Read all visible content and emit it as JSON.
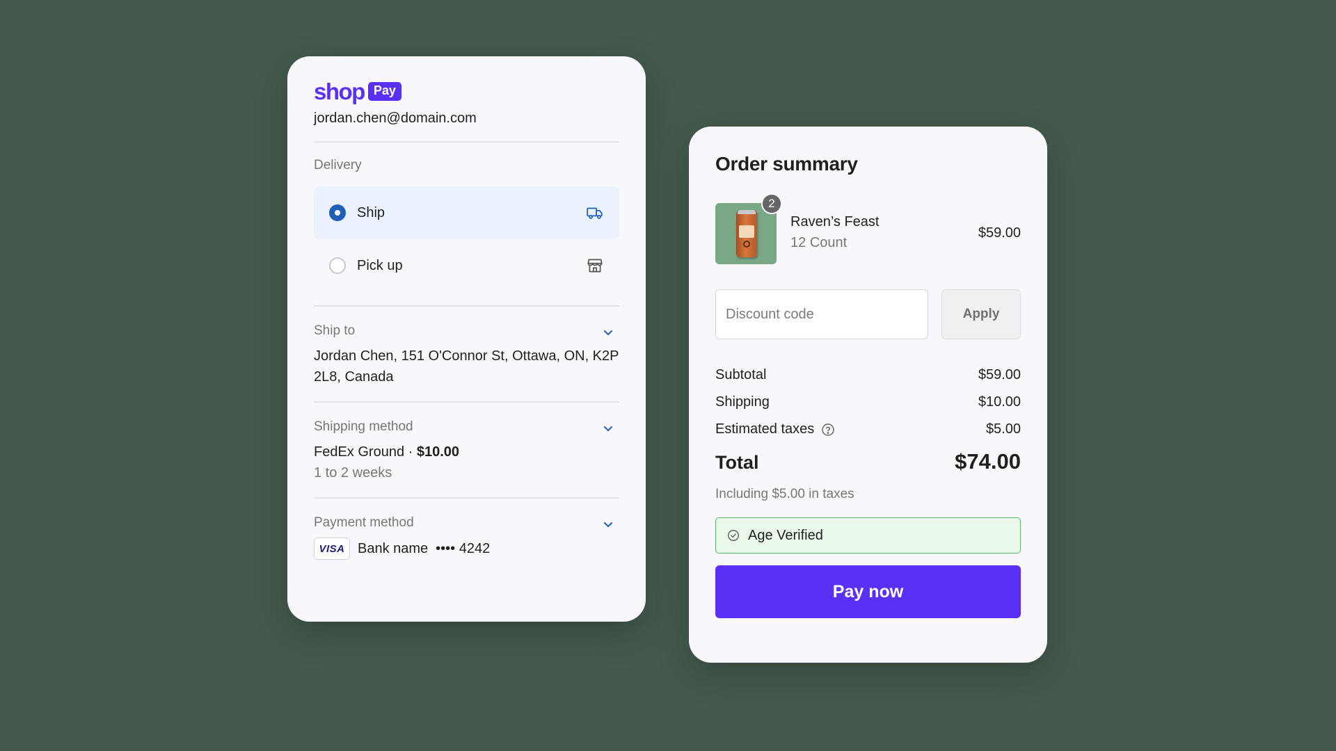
{
  "colors": {
    "background": "#445a4d",
    "brand": "#5a31f4",
    "selected_option": "#ebf2fd",
    "radio_on": "#1e5fb8",
    "age_ok": "#5db56b"
  },
  "checkout": {
    "brand": {
      "shop": "shop",
      "pay": "Pay"
    },
    "email": "jordan.chen@domain.com",
    "delivery": {
      "label": "Delivery",
      "options": [
        {
          "label": "Ship",
          "selected": true,
          "icon": "truck-icon"
        },
        {
          "label": "Pick up",
          "selected": false,
          "icon": "store-icon"
        }
      ]
    },
    "ship_to": {
      "label": "Ship to",
      "address": "Jordan Chen, 151 O'Connor St, Ottawa, ON, K2P 2L8, Canada"
    },
    "shipping_method": {
      "label": "Shipping method",
      "name": "FedEx Ground · ",
      "price": "$10.00",
      "eta": "1 to 2 weeks"
    },
    "payment_method": {
      "label": "Payment method",
      "card_brand": "VISA",
      "bank": "Bank name",
      "masked": "•••• 4242"
    }
  },
  "summary": {
    "title": "Order summary",
    "item": {
      "name": "Raven’s Feast",
      "variant": "12 Count",
      "price": "$59.00",
      "quantity": "2"
    },
    "discount": {
      "placeholder": "Discount code",
      "apply_label": "Apply"
    },
    "lines": [
      {
        "label": "Subtotal",
        "value": "$59.00"
      },
      {
        "label": "Shipping",
        "value": "$10.00"
      },
      {
        "label": "Estimated taxes",
        "value": "$5.00"
      }
    ],
    "total": {
      "label": "Total",
      "value": "$74.00"
    },
    "tax_note": "Including $5.00 in taxes",
    "age_verified": "Age Verified",
    "pay_label": "Pay now"
  }
}
